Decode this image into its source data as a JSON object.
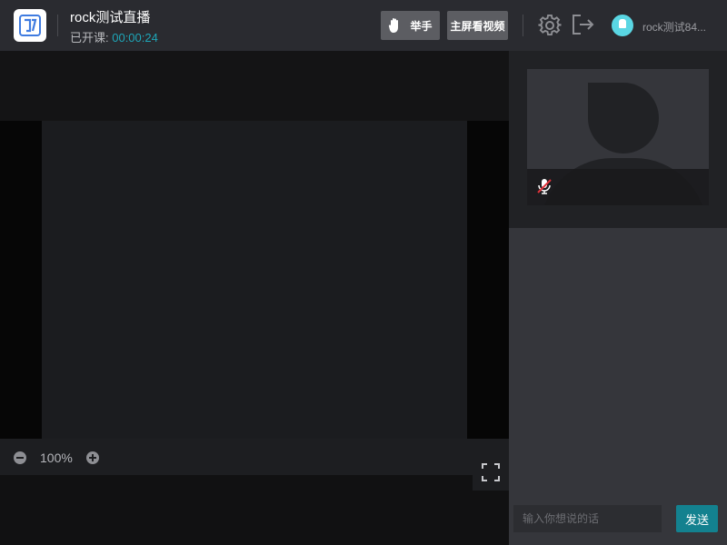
{
  "header": {
    "title": "rock测试直播",
    "status_label": "已开课: ",
    "elapsed_time": "00:00:24",
    "raise_hand_label": "举手",
    "main_screen_label": "主屏看视频",
    "username": "rock测试84..."
  },
  "stage": {
    "zoom_level": "100%"
  },
  "chat": {
    "input_placeholder": "输入你想说的话",
    "input_value": "",
    "send_label": "发送"
  },
  "icons": [
    "app-logo-icon",
    "raise-hand-icon",
    "gear-icon",
    "exit-icon",
    "zoom-out-icon",
    "zoom-in-icon",
    "fullscreen-icon",
    "mic-muted-icon"
  ],
  "colors": {
    "accent": "#1ea6b8",
    "send_button": "#13818f",
    "header_bg": "#2a2b30",
    "panel_bg": "#35363b",
    "muted_red": "#e0333a"
  }
}
